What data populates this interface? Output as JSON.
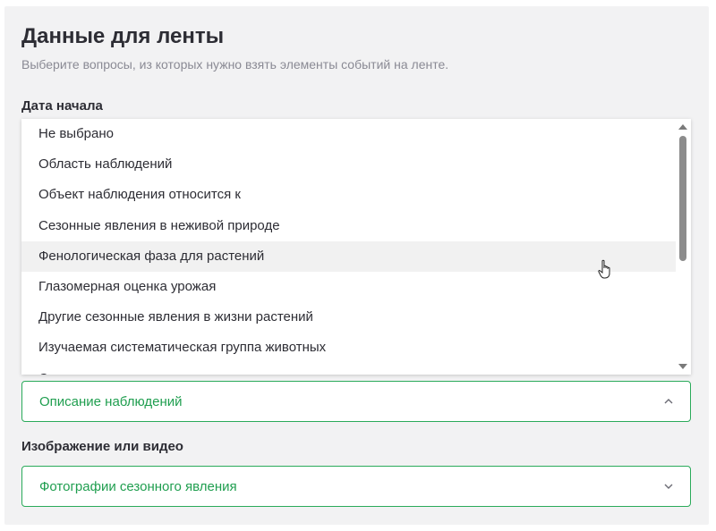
{
  "header": {
    "title": "Данные для ленты",
    "subtitle": "Выберите вопросы, из которых нужно взять элементы событий на ленте."
  },
  "start_date": {
    "label": "Дата начала",
    "options": [
      "Не выбрано",
      "Область наблюдений",
      "Объект наблюдения относится к",
      "Сезонные явления в неживой природе",
      "Фенологическая фаза для растений",
      "Глазомерная оценка урожая",
      "Другие сезонные явления в жизни растений",
      "Изучаемая систематическая группа животных",
      "Сезонные явления в жизни насекомых"
    ],
    "hovered_option": "Фенологическая фаза для растений"
  },
  "description_select": {
    "value": "Описание наблюдений"
  },
  "media": {
    "label": "Изображение или видео",
    "value": "Фотографии сезонного явления"
  },
  "colors": {
    "accent": "#2aaa5a",
    "accent_text": "#1f9e4f",
    "panel_bg": "#f2f2f3"
  }
}
